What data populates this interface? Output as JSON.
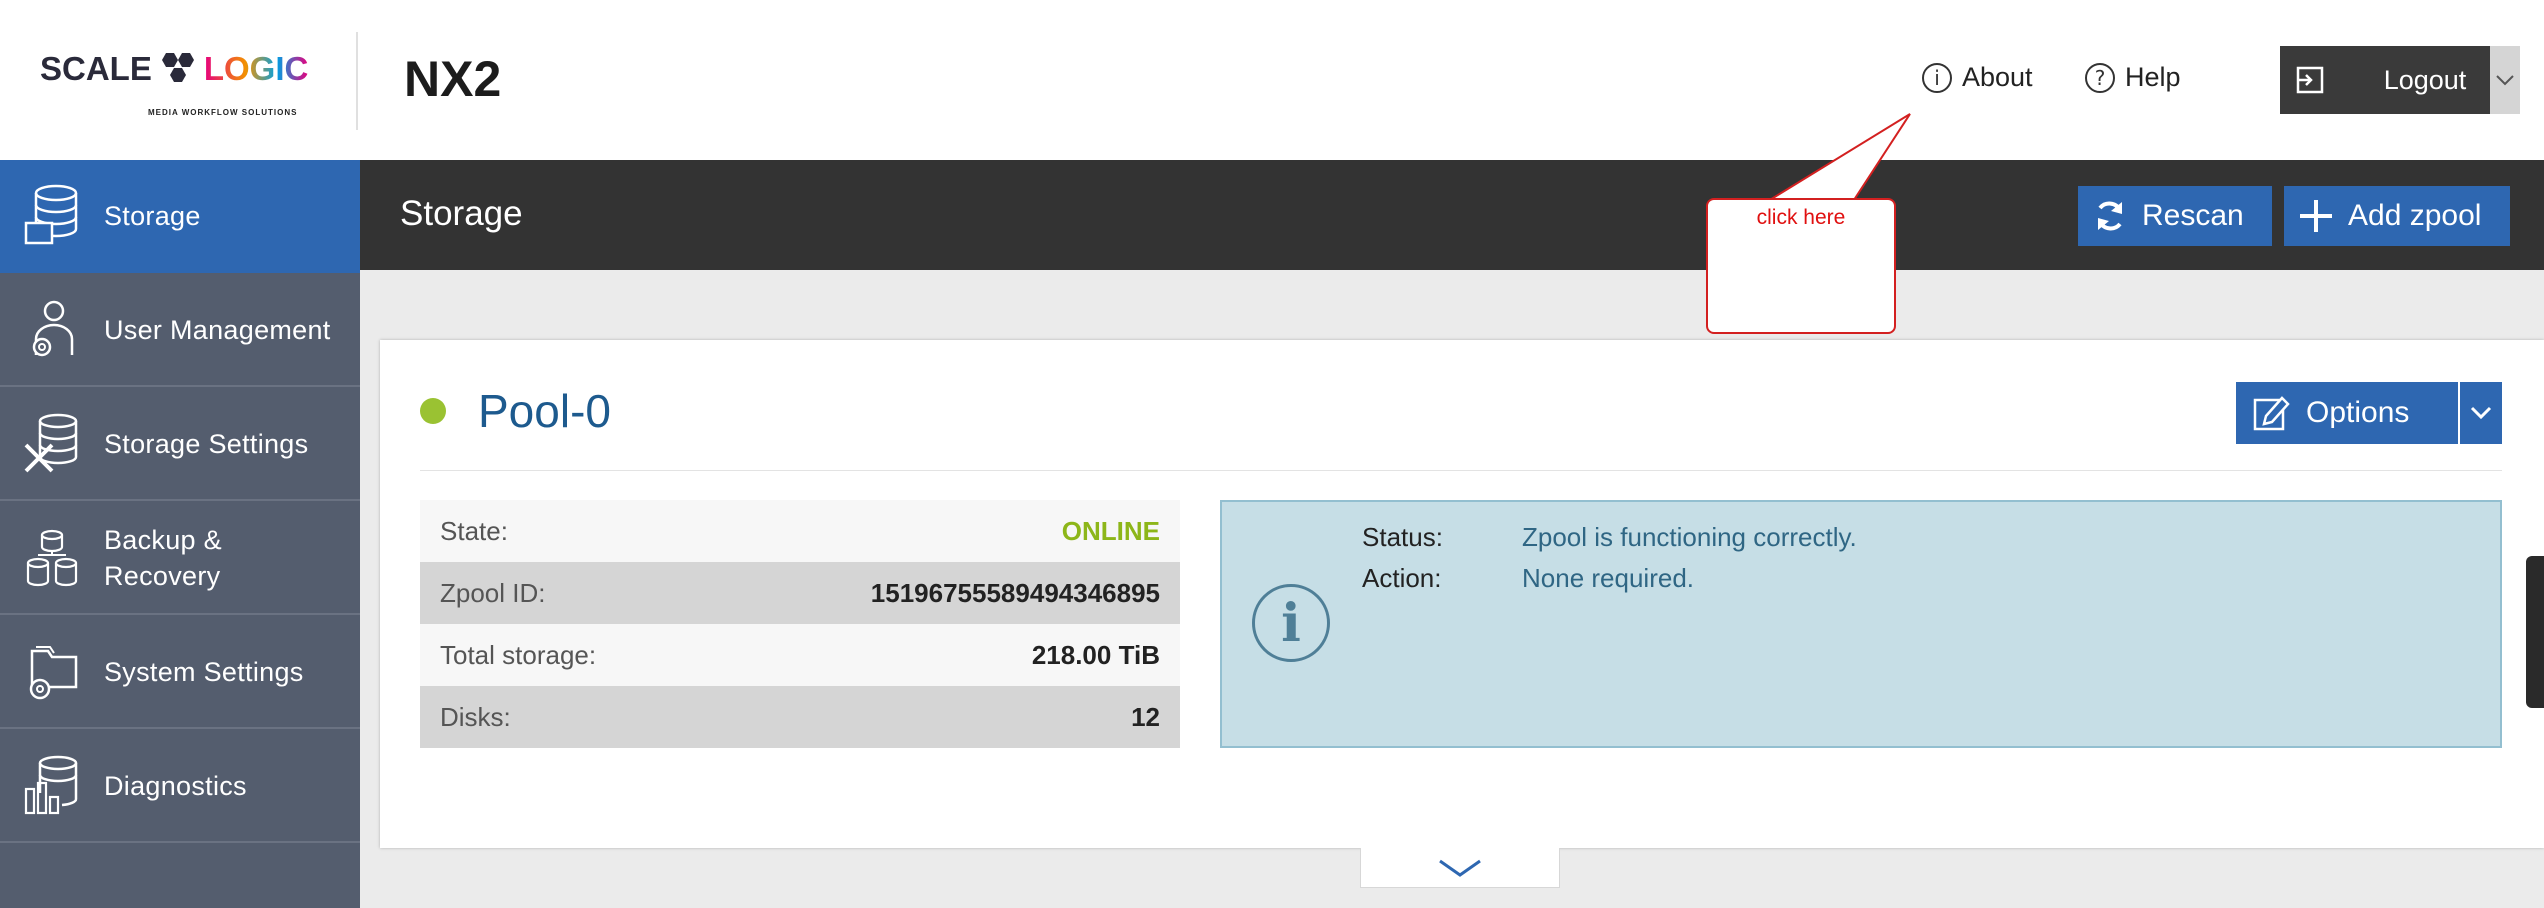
{
  "header": {
    "logo_left": "SCALE",
    "logo_right": "LOGIC",
    "logo_tagline": "MEDIA WORKFLOW SOLUTIONS",
    "product": "NX2",
    "about_label": "About",
    "help_label": "Help",
    "logout_label": "Logout"
  },
  "sidebar": {
    "items": [
      {
        "label": "Storage",
        "icon": "database-icon",
        "active": true
      },
      {
        "label": "User Management",
        "icon": "user-gear-icon"
      },
      {
        "label": "Storage Settings",
        "icon": "database-tools-icon"
      },
      {
        "label": "Backup & Recovery",
        "icon": "backup-icon"
      },
      {
        "label": "System Settings",
        "icon": "folder-gear-icon"
      },
      {
        "label": "Diagnostics",
        "icon": "database-chart-icon"
      }
    ]
  },
  "page": {
    "title": "Storage",
    "rescan_label": "Rescan",
    "add_zpool_label": "Add zpool"
  },
  "tooltip": {
    "text": "click here"
  },
  "pool": {
    "name": "Pool-0",
    "options_label": "Options",
    "details": [
      {
        "key": "State:",
        "value": "ONLINE"
      },
      {
        "key": "Zpool ID:",
        "value": "15196755589494346895"
      },
      {
        "key": "Total storage:",
        "value": "218.00 TiB"
      },
      {
        "key": "Disks:",
        "value": "12"
      }
    ],
    "status_label": "Status:",
    "status_value": "Zpool is functioning correctly.",
    "action_label": "Action:",
    "action_value": "None required."
  },
  "colors": {
    "brand_blue": "#2e67b1",
    "sidebar_bg": "#545d6e",
    "online_green": "#8db619",
    "status_dot": "#9ac232",
    "info_bg": "#c6dee6"
  }
}
